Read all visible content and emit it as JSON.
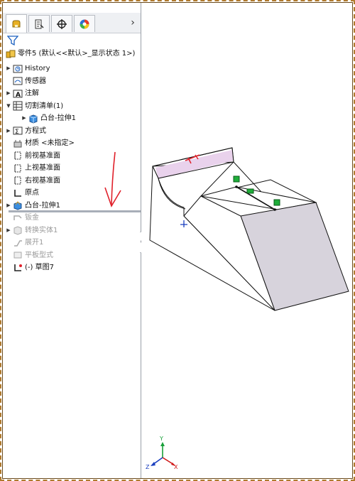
{
  "tabs": [
    {
      "name": "feature-manager",
      "icon": "feature-manager-icon"
    },
    {
      "name": "property-manager",
      "icon": "property-manager-icon"
    },
    {
      "name": "configuration-manager",
      "icon": "crosshair-icon"
    },
    {
      "name": "display-manager",
      "icon": "appearance-wheel-icon"
    }
  ],
  "more_tabs_glyph": "›",
  "tree": {
    "root_label": "零件5  (默认<<默认>_显示状态 1>)",
    "items": [
      {
        "label": "History",
        "icon": "history-icon",
        "expandable": true,
        "dim": false
      },
      {
        "label": "传感器",
        "icon": "sensor-icon",
        "expandable": false,
        "dim": false
      },
      {
        "label": "注解",
        "icon": "annotation-icon",
        "expandable": true,
        "dim": false
      },
      {
        "label": "切割清单(1)",
        "icon": "cut-list-icon",
        "expandable": true,
        "expanded": true,
        "dim": false
      },
      {
        "label": "凸台-拉伸1",
        "icon": "solid-body-icon",
        "expandable": true,
        "dim": false,
        "child": true
      },
      {
        "label": "方程式",
        "icon": "equation-icon",
        "expandable": true,
        "dim": false
      },
      {
        "label": "材质 <未指定>",
        "icon": "material-icon",
        "expandable": false,
        "dim": false
      },
      {
        "label": "前视基准面",
        "icon": "plane-icon",
        "expandable": false,
        "dim": false
      },
      {
        "label": "上视基准面",
        "icon": "plane-icon",
        "expandable": false,
        "dim": false
      },
      {
        "label": "右视基准面",
        "icon": "plane-icon",
        "expandable": false,
        "dim": false
      },
      {
        "label": "原点",
        "icon": "origin-icon",
        "expandable": false,
        "dim": false
      },
      {
        "label": "凸台-拉伸1",
        "icon": "extrude-icon",
        "expandable": true,
        "dim": false
      },
      {
        "label": "钣金",
        "icon": "sheet-metal-icon",
        "expandable": false,
        "dim": true
      },
      {
        "label": "转换实体1",
        "icon": "convert-entities-icon",
        "expandable": true,
        "dim": true
      },
      {
        "label": "展开1",
        "icon": "unfold-icon",
        "expandable": false,
        "dim": true
      },
      {
        "label": "平板型式",
        "icon": "flat-pattern-icon",
        "expandable": false,
        "dim": true
      },
      {
        "label": "(-) 草图7",
        "icon": "sketch-icon",
        "expandable": false,
        "dim": false
      }
    ]
  },
  "triad": {
    "x": "X",
    "y": "Y",
    "z": "Z"
  },
  "colors": {
    "annotation_arrow": "#e0202a",
    "selection_handle": "#1fae3a",
    "highlight_face": "#e9d2ec",
    "shaded_face": "#d7d3dc"
  }
}
